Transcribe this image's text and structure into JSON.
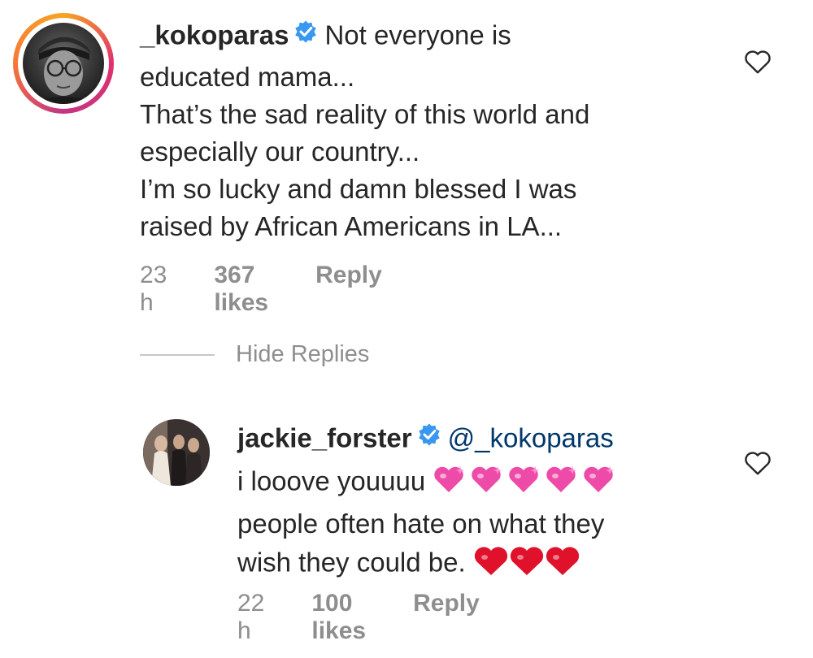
{
  "comments": [
    {
      "username": "_kokoparas",
      "text_line_1": "Not everyone is",
      "text_lines": [
        "educated mama...",
        "That’s the sad reality of this world and",
        "especially our country...",
        "I’m so lucky and damn blessed I was",
        "raised by African Americans in LA..."
      ],
      "time": "23 h",
      "likes": "367 likes",
      "reply_label": "Reply",
      "verified": true
    }
  ],
  "replies_toggle": {
    "label": "Hide Replies"
  },
  "replies": [
    {
      "username": "jackie_forster",
      "mention": "@_kokoparas",
      "text_line_1": "i looove youuuu",
      "text_line_2": "people often hate on what they",
      "text_line_3": "wish they could be.",
      "emoji_1": "pink-sparkling-hearts-x5",
      "emoji_2": "red-hearts-x3",
      "time": "22 h",
      "likes": "100 likes",
      "reply_label": "Reply",
      "verified": true
    }
  ],
  "colors": {
    "text": "#262626",
    "meta": "#8e8e8e",
    "verified": "#3897f0",
    "mention": "#00376b",
    "heart_red": "#e0112b",
    "heart_pink": "#ee4aa8"
  }
}
